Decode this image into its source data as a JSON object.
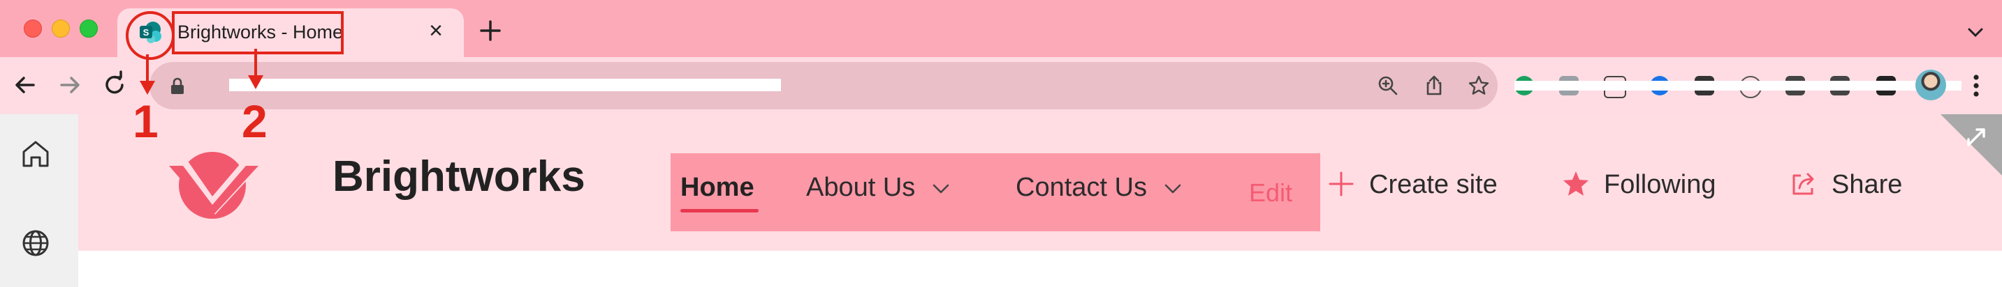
{
  "browser": {
    "tab": {
      "title": "Brightworks - Home",
      "close_glyph": "×",
      "favicon": "sharepoint-icon"
    },
    "new_tab_glyph": "+",
    "address_bar": {
      "url": ""
    },
    "colors": {
      "tabstrip": "#fdaab8",
      "toolbar": "#ffdce3",
      "omnibox": "#eabfc7"
    }
  },
  "site": {
    "title": "Brightworks",
    "nav": [
      {
        "label": "Home",
        "active": true
      },
      {
        "label": "About Us",
        "has_dropdown": true
      },
      {
        "label": "Contact Us",
        "has_dropdown": true
      }
    ],
    "nav_edit": "Edit",
    "commands": [
      {
        "label": "Create site",
        "icon": "plus-icon"
      },
      {
        "label": "Following",
        "icon": "star-icon"
      },
      {
        "label": "Share",
        "icon": "share-icon"
      }
    ],
    "colors": {
      "header": "#ffdde3",
      "nav": "#fd98a7",
      "accent": "#f2586d"
    }
  },
  "annotations": [
    {
      "number": "1",
      "target": "tab favicon"
    },
    {
      "number": "2",
      "target": "tab title"
    }
  ]
}
